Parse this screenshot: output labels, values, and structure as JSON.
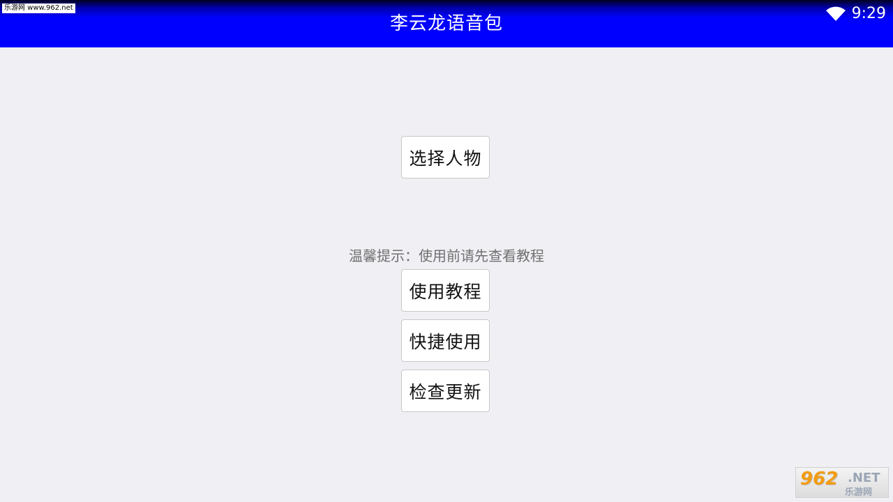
{
  "header": {
    "title": "李云龙语音包",
    "watermark": "乐游网 www.962.net",
    "time": "9:29",
    "wifi_icon": "wifi-icon"
  },
  "buttons": {
    "select_character": "选择人物",
    "tutorial": "使用教程",
    "quick_use": "快捷使用",
    "check_update": "检查更新"
  },
  "tip": "温馨提示：使用前请先查看教程",
  "corner_logo": {
    "number": "962",
    "domain": ".NET",
    "name": "乐游网"
  },
  "colors": {
    "header_blue": "#0000ff",
    "background": "#efeff4",
    "tip_text": "#707070"
  }
}
